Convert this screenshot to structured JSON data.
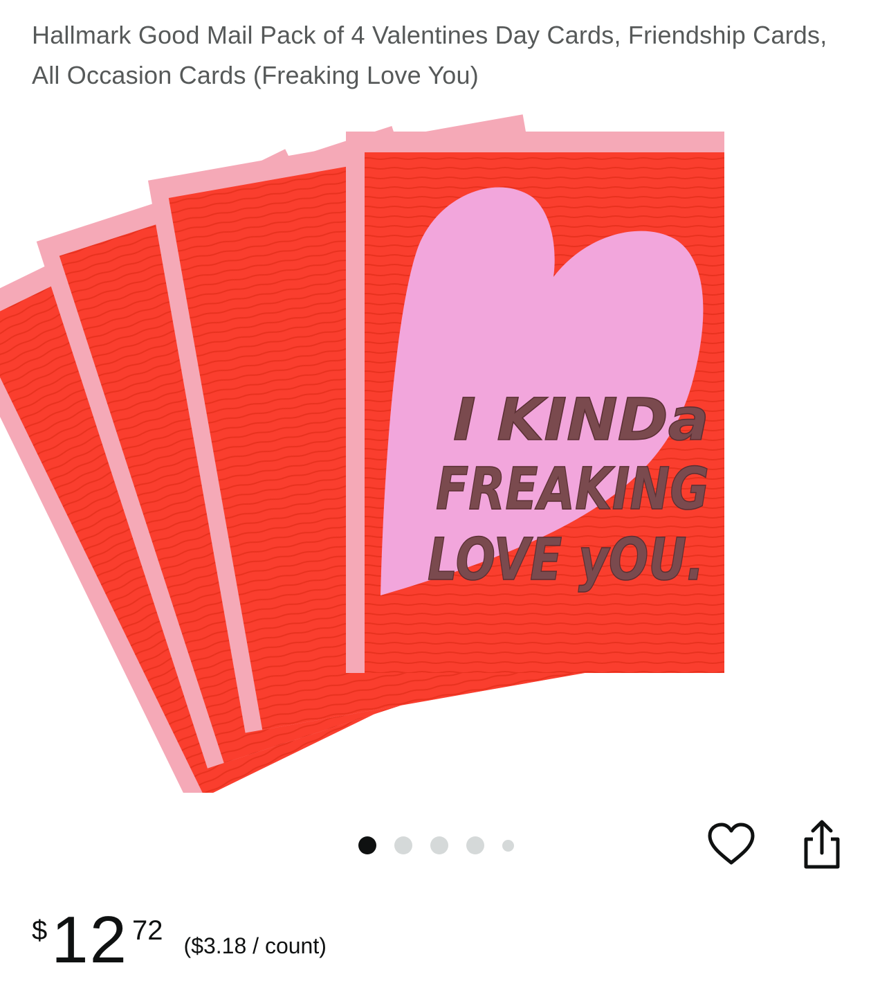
{
  "product": {
    "title": "Hallmark Good Mail Pack of 4 Valentines Day Cards, Friendship Cards, All Occasion Cards (Freaking Love You)"
  },
  "image": {
    "card_text_lines": [
      "I KINDa",
      "FREAKING",
      "LOVE yOU."
    ],
    "colors": {
      "card_red": "#fa3e2e",
      "card_stripe": "#e8321f",
      "envelope_pink": "#f5a9b7",
      "heart_pink": "#f2a6dc",
      "lettering": "#7a4a4e"
    }
  },
  "carousel": {
    "total_dots": 5,
    "active_index": 0
  },
  "actions": {
    "wishlist_icon": "heart-outline-icon",
    "share_icon": "share-icon"
  },
  "price": {
    "symbol": "$",
    "whole": "12",
    "fraction": "72",
    "unit_price": "($3.18 / count)"
  }
}
